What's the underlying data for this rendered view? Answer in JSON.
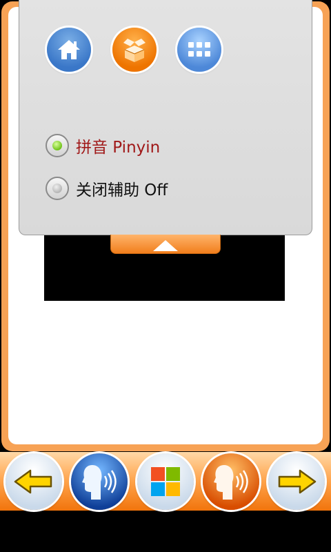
{
  "top_menu": {
    "icons": [
      "home-icon",
      "box-icon",
      "grid-icon"
    ]
  },
  "options": {
    "pinyin_label": "拼音 Pinyin",
    "pinyin_selected": true,
    "off_label": "关闭辅助 Off",
    "off_selected": false
  },
  "bottom_bar": {
    "icons": [
      "arrow-left-icon",
      "speak-icon",
      "windows-icon",
      "speak-icon",
      "arrow-right-icon"
    ]
  },
  "colors": {
    "frame": "#f7a255",
    "pinyin_text": "#a01818",
    "selected_dot": "#6fc218"
  }
}
